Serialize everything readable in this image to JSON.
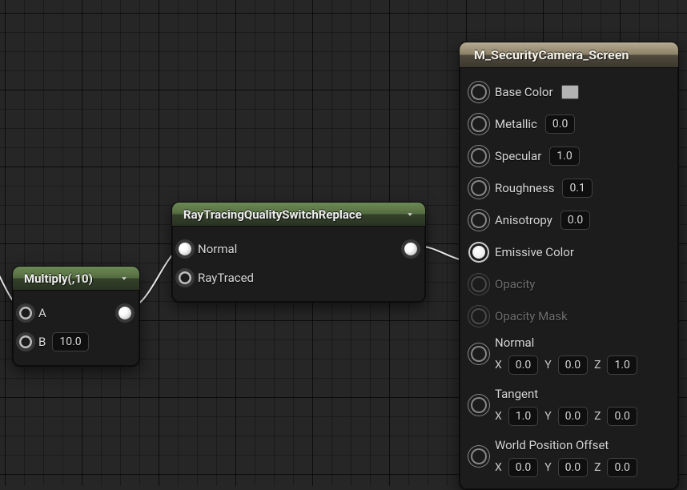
{
  "nodes": {
    "multiply": {
      "title": "Multiply(,10)",
      "input_a_label": "A",
      "input_b_label": "B",
      "input_b_value": "10.0"
    },
    "rtqs": {
      "title": "RayTracingQualitySwitchReplace",
      "input_normal_label": "Normal",
      "input_raytraced_label": "RayTraced"
    },
    "material": {
      "title": "M_SecurityCamera_Screen",
      "pins": {
        "base_color": {
          "label": "Base Color"
        },
        "metallic": {
          "label": "Metallic",
          "value": "0.0"
        },
        "specular": {
          "label": "Specular",
          "value": "1.0"
        },
        "roughness": {
          "label": "Roughness",
          "value": "0.1"
        },
        "anisotropy": {
          "label": "Anisotropy",
          "value": "0.0"
        },
        "emissive": {
          "label": "Emissive Color"
        },
        "opacity": {
          "label": "Opacity"
        },
        "opacity_mask": {
          "label": "Opacity Mask"
        },
        "normal": {
          "label": "Normal",
          "x": "0.0",
          "y": "0.0",
          "z": "1.0"
        },
        "tangent": {
          "label": "Tangent",
          "x": "1.0",
          "y": "0.0",
          "z": "0.0"
        },
        "world_pos_offset": {
          "label": "World Position Offset",
          "x": "0.0",
          "y": "0.0",
          "z": "0.0"
        }
      },
      "axis_labels": {
        "x": "X",
        "y": "Y",
        "z": "Z"
      }
    }
  }
}
